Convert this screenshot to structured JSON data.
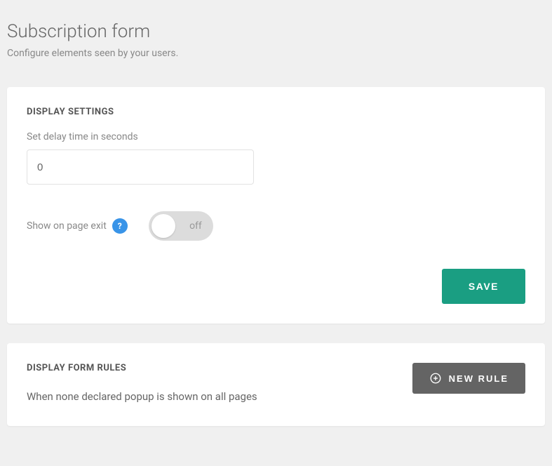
{
  "page": {
    "title": "Subscription form",
    "subtitle": "Configure elements seen by your users."
  },
  "display_settings": {
    "heading": "DISPLAY SETTINGS",
    "delay_label": "Set delay time in seconds",
    "delay_value": "0",
    "exit_label": "Show on page exit",
    "help_char": "?",
    "toggle_state": "off",
    "save_label": "SAVE"
  },
  "display_rules": {
    "heading": "DISPLAY FORM RULES",
    "description": "When none declared popup is shown on all pages",
    "new_rule_label": "NEW RULE"
  }
}
